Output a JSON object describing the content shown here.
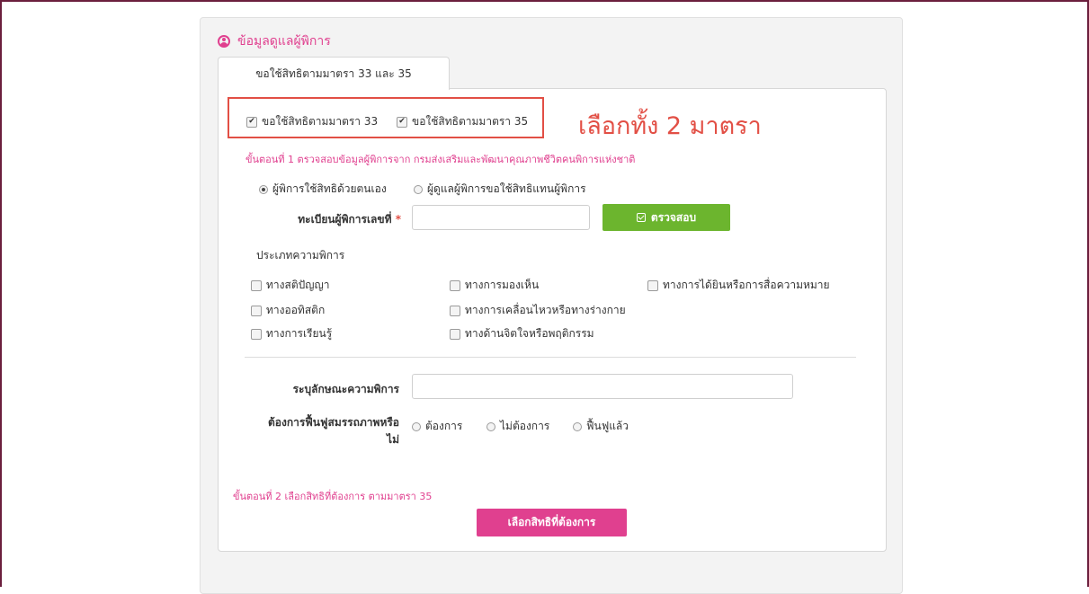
{
  "section": {
    "title": "ข้อมูลดูแลผู้พิการ",
    "icon": "user-circle-icon"
  },
  "tab": {
    "label": "ขอใช้สิทธิตามมาตรา 33 และ 35"
  },
  "rights": [
    {
      "label": "ขอใช้สิทธิตามมาตรา 33",
      "checked": true
    },
    {
      "label": "ขอใช้สิทธิตามมาตรา 35",
      "checked": true
    }
  ],
  "annotation": "เลือกทั้ง 2 มาตรา",
  "step1": "ขั้นตอนที่ 1 ตรวจสอบข้อมูลผู้พิการจาก กรมส่งเสริมและพัฒนาคุณภาพชีวิตคนพิการแห่งชาติ",
  "applicant": {
    "self": "ผู้พิการใช้สิทธิด้วยตนเอง",
    "caregiver": "ผู้ดูแลผู้พิการขอใช้สิทธิแทนผู้พิการ",
    "selected": "self"
  },
  "registration": {
    "label": "ทะเบียนผู้พิการเลขที่",
    "required_mark": "*",
    "value": ""
  },
  "verify_button": "ตรวจสอบ",
  "disability_types": {
    "heading": "ประเภทความพิการ",
    "items": [
      "ทางสติปัญญา",
      "ทางการมองเห็น",
      "ทางการได้ยินหรือการสื่อความหมาย",
      "ทางออทิสติก",
      "ทางการเคลื่อนไหวหรือทางร่างกาย",
      "ทางการเรียนรู้",
      "ทางด้านจิตใจหรือพฤติกรรม"
    ]
  },
  "describe": {
    "label": "ระบุลักษณะความพิการ",
    "value": ""
  },
  "rehab": {
    "label_line1": "ต้องการฟื้นฟูสมรรถภาพหรือ",
    "label_line2": "ไม่",
    "options": [
      "ต้องการ",
      "ไม่ต้องการ",
      "ฟื้นฟูแล้ว"
    ]
  },
  "step2": "ขั้นตอนที่ 2 เลือกสิทธิที่ต้องการ ตามมาตรา 35",
  "select_rights_button": "เลือกสิทธิที่ต้องการ",
  "colors": {
    "accent": "#e0408f",
    "green": "#6cb52e",
    "annotation": "#e24f45"
  }
}
